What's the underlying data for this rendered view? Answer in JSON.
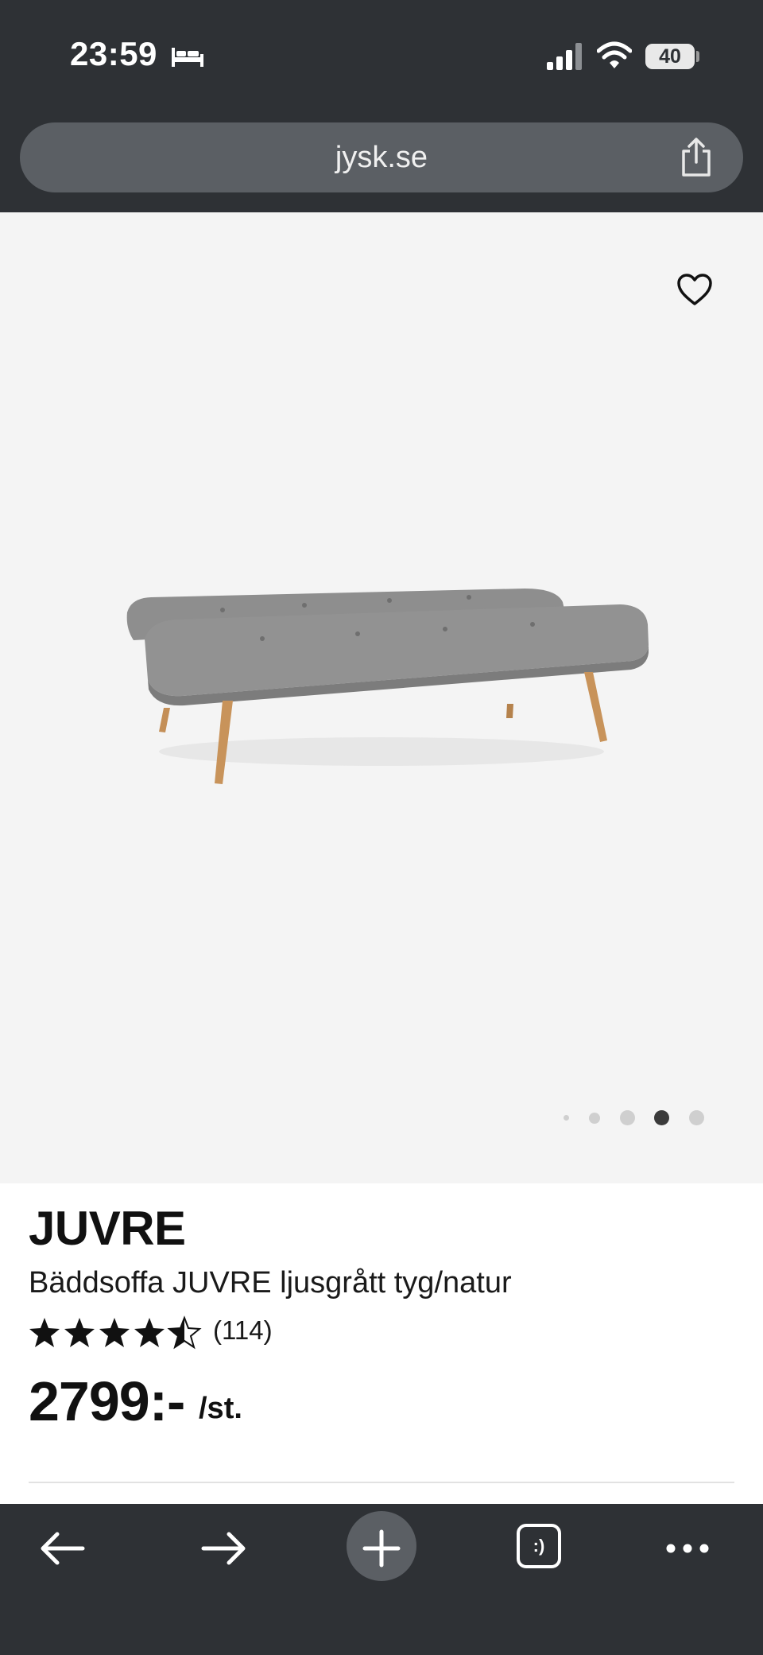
{
  "status_bar": {
    "time": "23:59",
    "battery": "40",
    "icons": [
      "bed-icon",
      "signal-icon",
      "wifi-icon",
      "battery-icon"
    ]
  },
  "browser": {
    "url": "jysk.se",
    "icons": [
      "share-icon"
    ]
  },
  "product": {
    "brand": "JUVRE",
    "name": "Bäddsoffa JUVRE ljusgrått tyg/natur",
    "rating": 4.5,
    "rating_max": 5,
    "review_count": "(114)",
    "price": "2799:-",
    "price_unit": "/st.",
    "image_count": 5,
    "active_image": 4,
    "favorite_icon": "heart-icon"
  },
  "toolbar": {
    "icons": [
      "back-arrow-icon",
      "forward-arrow-icon",
      "plus-icon",
      "tabs-icon",
      "more-icon"
    ],
    "tabs_label": ":)"
  },
  "colors": {
    "chrome": "#2e3135",
    "urlbar": "#5b5f64",
    "hero_bg": "#f4f4f4",
    "active_dot": "#3a3a3a"
  }
}
